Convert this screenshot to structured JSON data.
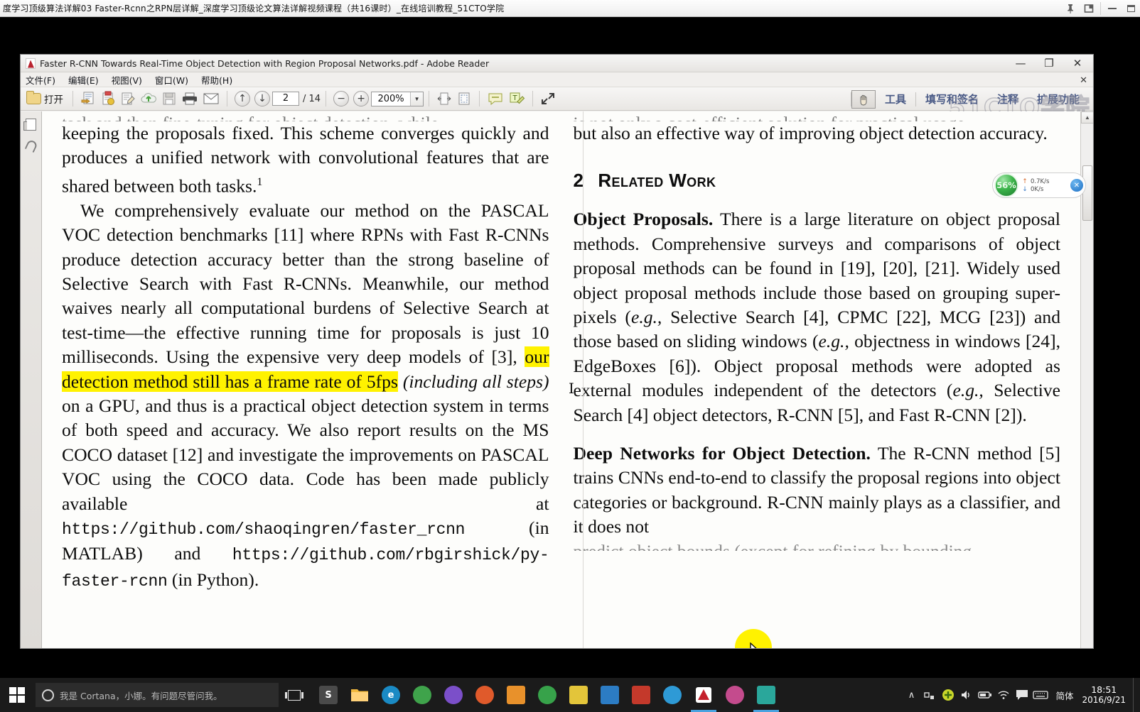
{
  "browser": {
    "title": "度学习顶级算法详解03 Faster-Rcnn之RPN层详解_深度学习顶级论文算法详解视频课程（共16课时）_在线培训教程_51CTO学院",
    "controls": {
      "pin": "pin-icon",
      "popout": "popout-icon",
      "minimize": "—",
      "restore": "❐"
    }
  },
  "adobe": {
    "title": "Faster R-CNN Towards Real-Time Object Detection with Region Proposal Networks.pdf - Adobe Reader",
    "window_controls": {
      "minimize": "—",
      "restore": "❐",
      "close": "✕"
    },
    "menus": [
      {
        "label": "文件(F)"
      },
      {
        "label": "编辑(E)"
      },
      {
        "label": "视图(V)"
      },
      {
        "label": "窗口(W)"
      },
      {
        "label": "帮助(H)"
      }
    ],
    "menubar_close": "✕",
    "toolbar": {
      "open_label": "打开",
      "page_value": "2",
      "page_total": "/ 14",
      "zoom_value": "200%",
      "zoom_out": "−",
      "zoom_in": "+",
      "prev_page": "↑",
      "next_page": "↓",
      "caret": "▼",
      "right_links": [
        {
          "label": "工具"
        },
        {
          "label": "填写和签名"
        },
        {
          "label": "注释"
        },
        {
          "label": "扩展功能"
        }
      ]
    },
    "watermark": "51CTO学院"
  },
  "speed_widget": {
    "percent": "56%",
    "upload": "0.7K/s",
    "download": "0K/s",
    "up_arrow": "↑",
    "down_arrow": "↓",
    "close": "✕"
  },
  "document": {
    "left_column": {
      "cut_top_line": "task and then fine-tuning for object detection, while",
      "para1": [
        {
          "t": "keeping the proposals fixed. This scheme converges quickly and produces a unified network with convolutional features that are shared between both tasks."
        },
        {
          "t": "1",
          "sup": true
        }
      ],
      "para2_pre": "We comprehensively evaluate our method on the PASCAL VOC detection benchmarks [11] where RPNs with Fast R-CNNs produce detection accuracy better than the strong baseline of Selective Search with Fast R-CNNs. Meanwhile, our method waives nearly all computational burdens of Selective Search at test-time—the effective running time for proposals is just 10 milliseconds. Using the expensive very deep models of [3], ",
      "para2_hl": "our detection method still has a frame rate of 5fps",
      "para2_post_it": "(including all steps)",
      "para2_post": " on a GPU, and thus is a practical object detection system in terms of both speed and accuracy. We also report results on the MS COCO dataset [12] and investigate the improvements on PASCAL VOC using the COCO data. Code has been made publicly available at ",
      "url1": "https://github.com/shaoqingren/faster_rcnn",
      "mid1": " (in MATLAB) and ",
      "url2": "https://github.com/rbgirshick/py-faster-rcnn",
      "mid2": " (in Python)."
    },
    "right_column": {
      "cut_top_line": "is not only a cost-efficient solution for practical usage,",
      "para0": "but also an effective way of improving object detection accuracy.",
      "section_number": "2",
      "section_title": "Related Work",
      "h_obj_proposals": "Object Proposals.",
      "para_obj_1": " There is a large literature on object proposal methods. Comprehensive surveys and comparisons of object proposal methods can be found in [19], [20], [21]. Widely used object proposal methods include those based on grouping super-pixels (",
      "eg1": "e.g.,",
      "para_obj_2": " Selective Search [4], CPMC [22], MCG [23]) and those based on sliding windows (",
      "eg2": "e.g.,",
      "para_obj_3": " objectness in windows [24], EdgeBoxes [6]). Object proposal methods were adopted as external modules independent of the detectors (",
      "eg3": "e.g.,",
      "para_obj_4": " Selective Search [4] object detectors, R-CNN [5], and Fast R-CNN [2]).",
      "h_deep_networks": "Deep Networks for Object Detection.",
      "para_deep": " The R-CNN method [5] trains CNNs end-to-end to classify the proposal regions into object categories or background. R-CNN mainly plays as a classifier, and it does not",
      "cut_bottom_line": "predict object bounds (except for refining by bounding"
    }
  },
  "taskbar": {
    "cortana_placeholder": "我是 Cortana，小娜。有问题尽管问我。",
    "apps": [
      {
        "name": "taskview-icon",
        "label": "",
        "color": "transparent"
      },
      {
        "name": "store-icon",
        "label": "S",
        "color": "#5a5a5a"
      },
      {
        "name": "file-explorer-icon",
        "label": "",
        "color": "#f3b13f"
      },
      {
        "name": "edge-icon",
        "label": "e",
        "color": "#1a8ac4"
      },
      {
        "name": "chrome-icon",
        "label": "",
        "color": "#3fa34b"
      },
      {
        "name": "app-purple-icon",
        "label": "",
        "color": "#7b4fc9"
      },
      {
        "name": "app-flower-icon",
        "label": "",
        "color": "#e05a2b"
      },
      {
        "name": "app-orange-icon",
        "label": "",
        "color": "#e8912b"
      },
      {
        "name": "app-green-icon",
        "label": "",
        "color": "#37a24a"
      },
      {
        "name": "app-yellow-icon",
        "label": "",
        "color": "#e3c53a"
      },
      {
        "name": "app-win-icon",
        "label": "",
        "color": "#2c7cc4"
      },
      {
        "name": "app-red-icon",
        "label": "",
        "color": "#c4392b"
      },
      {
        "name": "app-blue-icon",
        "label": "",
        "color": "#2e9ad6"
      },
      {
        "name": "adobe-reader-icon",
        "label": "",
        "color": "#c4202b"
      },
      {
        "name": "app-pink-icon",
        "label": "",
        "color": "#c44b8d"
      },
      {
        "name": "app-teal-icon",
        "label": "",
        "color": "#2aa79b"
      }
    ],
    "tray": {
      "chevron": "∧",
      "network_icon": "network-icon",
      "shield_icon": "shield-icon",
      "volume_icon": "volume-icon",
      "battery_icon": "battery-icon",
      "wifi_icon": "wifi-icon",
      "action_center_icon": "action-center-icon",
      "keyboard_icon": "keyboard-icon",
      "ime": "简体",
      "time": "18:51",
      "date": "2016/9/21"
    }
  }
}
